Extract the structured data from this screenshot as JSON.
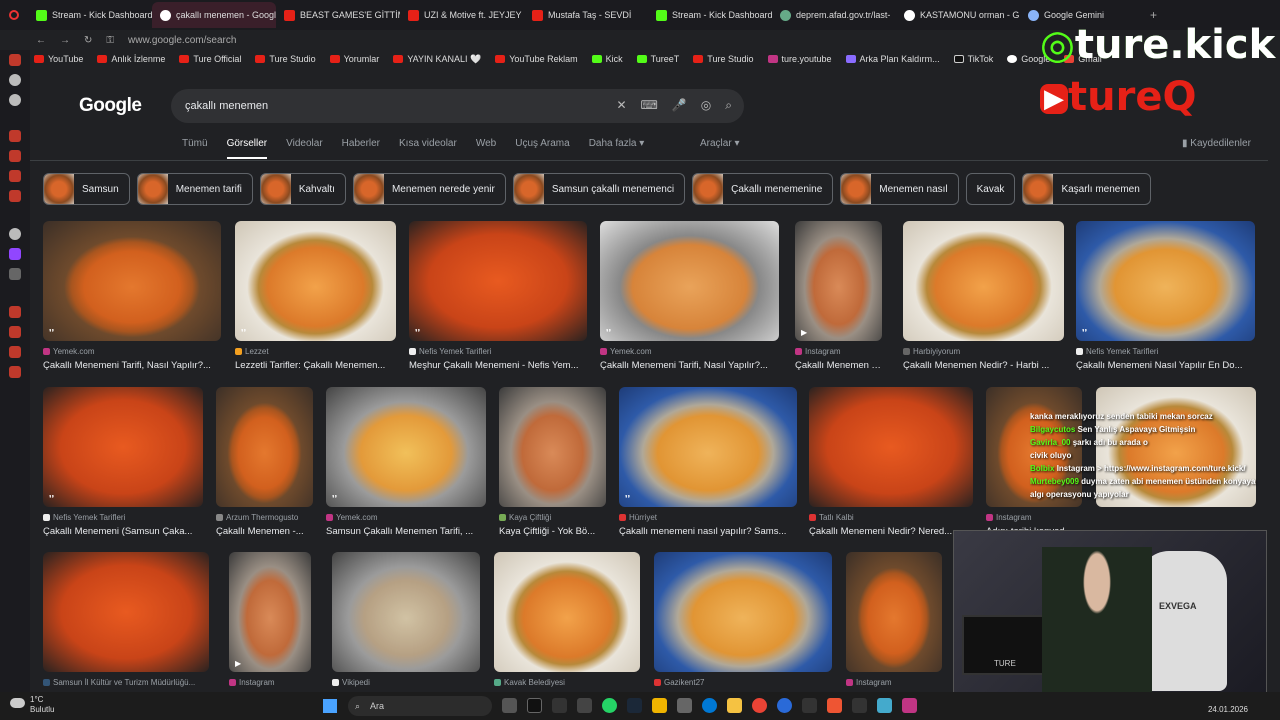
{
  "browser": {
    "tabs": [
      {
        "label": "Stream - Kick Dashboard",
        "icon": "kick"
      },
      {
        "label": "çakallı menemen - Google",
        "icon": "g",
        "active": true
      },
      {
        "label": "BEAST GAMES'E GİTTİM",
        "icon": "yt"
      },
      {
        "label": "UZI & Motive ft. JEYJEY",
        "icon": "yt"
      },
      {
        "label": "Mustafa Taş - SEVDİ",
        "icon": "yt"
      },
      {
        "label": "Stream - Kick Dashboard",
        "icon": "kick"
      },
      {
        "label": "deprem.afad.gov.tr/last-",
        "icon": "glob"
      },
      {
        "label": "KASTAMONU orman - G",
        "icon": "g"
      },
      {
        "label": "Google Gemini",
        "icon": "gem"
      }
    ],
    "url": "www.google.com/search",
    "bookmarks": [
      {
        "label": "YouTube",
        "icon": "yt"
      },
      {
        "label": "Anlık İzlenme",
        "icon": "yt"
      },
      {
        "label": "Ture Official",
        "icon": "yt"
      },
      {
        "label": "Ture Studio",
        "icon": "yt"
      },
      {
        "label": "Yorumlar",
        "icon": "yt"
      },
      {
        "label": "YAYIN KANALI 🤍",
        "icon": "yt"
      },
      {
        "label": "YouTube Reklam",
        "icon": "yt"
      },
      {
        "label": "Kick",
        "icon": "k"
      },
      {
        "label": "TureeT",
        "icon": "k"
      },
      {
        "label": "Ture Studio",
        "icon": "yt"
      },
      {
        "label": "ture.youtube",
        "icon": "ig"
      },
      {
        "label": "Arka Plan Kaldırm...",
        "icon": "p"
      },
      {
        "label": "TikTok",
        "icon": "tt"
      },
      {
        "label": "Google",
        "icon": "g"
      },
      {
        "label": "Gmail",
        "icon": "gm"
      }
    ]
  },
  "google": {
    "logo": "Google",
    "query": "çakallı menemen",
    "nav": [
      "Tümü",
      "Görseller",
      "Videolar",
      "Haberler",
      "Kısa videolar",
      "Web",
      "Uçuş Arama",
      "Daha fazla"
    ],
    "tools": "Araçlar",
    "saved": "Kaydedilenler",
    "chips": [
      {
        "label": "Samsun",
        "thumb": true
      },
      {
        "label": "Menemen tarifi",
        "thumb": true
      },
      {
        "label": "Kahvaltı",
        "thumb": true
      },
      {
        "label": "Menemen nerede yenir",
        "thumb": true
      },
      {
        "label": "Samsun çakallı menemenci",
        "thumb": true
      },
      {
        "label": "Çakallı menemenine",
        "thumb": true
      },
      {
        "label": "Menemen nasıl",
        "thumb": true
      },
      {
        "label": "Kavak",
        "thumb": false
      },
      {
        "label": "Kaşarlı menemen",
        "thumb": true
      }
    ],
    "results_row1": [
      {
        "source": "Yemek.com",
        "title": "Çakallı Menemeni Tarifi, Nasıl Yapılır?..."
      },
      {
        "source": "Lezzet",
        "title": "Lezzetli Tarifler: Çakallı Menemen..."
      },
      {
        "source": "Nefis Yemek Tarifleri",
        "title": "Meşhur Çakallı Menemeni - Nefis Yem..."
      },
      {
        "source": "Yemek.com",
        "title": "Çakallı Menemeni Tarifi, Nasıl Yapılır?..."
      },
      {
        "source": "Instagram",
        "title": "Çakallı Menemen T..."
      },
      {
        "source": "Harbiyiyorum",
        "title": "Çakallı Menemen Nedir? - Harbi ..."
      },
      {
        "source": "Nefis Yemek Tarifleri",
        "title": "Çakallı Menemeni Nasıl Yapılır En Do..."
      }
    ],
    "results_row2": [
      {
        "source": "Nefis Yemek Tarifleri",
        "title": "Çakallı Menemeni (Samsun Çaka..."
      },
      {
        "source": "Arzum Thermogusto",
        "title": "Çakallı Menemen -..."
      },
      {
        "source": "Yemek.com",
        "title": "Samsun Çakallı Menemen Tarifi, ..."
      },
      {
        "source": "Kaya Çiftliği",
        "title": "Kaya Çiftliği - Yok Bö..."
      },
      {
        "source": "Hürriyet",
        "title": "Çakallı menemeni nasıl yapılır? Sams..."
      },
      {
        "source": "Tatlı Kalbi",
        "title": "Çakallı Menemeni Nedir? Nered..."
      },
      {
        "source": "Instagram",
        "title": "Adını tarihi konyad..."
      }
    ],
    "results_row3": [
      {
        "source": "Samsun İl Kültür ve Turizm Müdürlüğü..."
      },
      {
        "source": "Instagram"
      },
      {
        "source": "Vikipedi"
      },
      {
        "source": "Kavak Belediyesi"
      },
      {
        "source": "Gazikent27"
      },
      {
        "source": "Instagram"
      }
    ]
  },
  "overlay": {
    "kick": "ture.kick",
    "youtube": "tureQ",
    "chat": [
      {
        "user": "",
        "msg": "kanka meraklıyoruz senden tabiki mekan sorcaz"
      },
      {
        "user": "Bilgaycutos",
        "msg": "Sen Yanlış Aspavaya Gitmişsin"
      },
      {
        "user": "Gavirla_00",
        "msg": "şarkı adı bu arada o"
      },
      {
        "user": "",
        "msg": "civik oluyo"
      },
      {
        "user": "Bolbix",
        "msg": "Instagram > https://www.instagram.com/ture.kick/"
      },
      {
        "user": "Murtebey009",
        "msg": "duyma zaten abi menemen üstünden konyaya algı operasyonu yapıyolar"
      }
    ],
    "cam_chair": "EXVEGA",
    "cam_monitor": "TURE"
  },
  "taskbar": {
    "temp": "1°C",
    "weather": "Bulutlu",
    "search": "Ara",
    "date": "24.01.2026"
  }
}
